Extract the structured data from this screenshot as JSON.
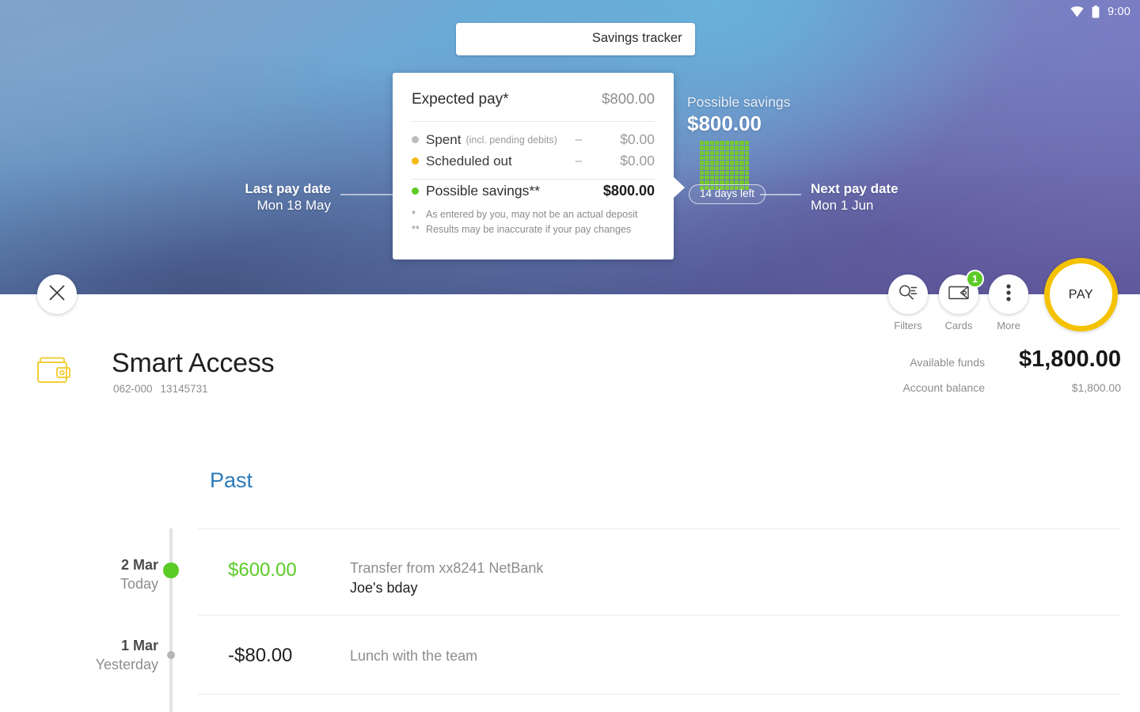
{
  "status_bar": {
    "wifi_icon": "wifi-icon",
    "battery_icon": "battery-icon",
    "time": "9:00"
  },
  "tabs": [
    {
      "label": "Running balance",
      "active": false
    },
    {
      "label": "Savings tracker",
      "active": true
    }
  ],
  "timeline": {
    "last_pay": {
      "title": "Last pay date",
      "date": "Mon 18 May"
    },
    "next_pay": {
      "title": "Next pay date",
      "date": "Mon 1 Jun"
    },
    "days_left_pill": "14 days left"
  },
  "savings_panel": {
    "title": "Possible savings",
    "amount": "$800.00",
    "grid_cells": 100,
    "grid_color": "#76c92c"
  },
  "detail_card": {
    "expected_pay": {
      "label": "Expected pay*",
      "amount": "$800.00"
    },
    "rows": [
      {
        "label": "Spent",
        "sub": "(incl. pending debits)",
        "dash": "–",
        "amount": "$0.00",
        "dot": "grey",
        "dot_color": "#bdbdbd"
      },
      {
        "label": "Scheduled out",
        "sub": "",
        "dash": "–",
        "amount": "$0.00",
        "dot": "amber",
        "dot_color": "#f6b911"
      }
    ],
    "possible_savings": {
      "label": "Possible savings**",
      "amount": "$800.00",
      "dot_color": "#5bcb26"
    },
    "notes": [
      {
        "marker": "*",
        "text": "As entered by you, may not be an actual deposit"
      },
      {
        "marker": "**",
        "text": "Results may be inaccurate if your pay changes"
      }
    ]
  },
  "toolbar": {
    "close_label": "close-icon",
    "items": [
      {
        "caption": "Filters",
        "icon": "search-filter-icon",
        "badge": null
      },
      {
        "caption": "Cards",
        "icon": "card-icon",
        "badge": "1"
      },
      {
        "caption": "More",
        "icon": "more-vertical-icon",
        "badge": null
      }
    ],
    "pay_label": "PAY",
    "pay_ring_color": "#f4c200"
  },
  "account": {
    "icon": "wallet-icon",
    "name": "Smart Access",
    "bsb": "062-000",
    "number": "13145731",
    "available_funds_label": "Available funds",
    "available_funds_value": "$1,800.00",
    "account_balance_label": "Account balance",
    "account_balance_value": "$1,800.00"
  },
  "transactions": {
    "section_title": "Past",
    "items": [
      {
        "date_day": "2 Mar",
        "date_rel": "Today",
        "amount": "$600.00",
        "amount_color": "#5bcb26",
        "description": "Transfer from xx8241 NetBank",
        "memo": "Joe's bday",
        "node": "large-green"
      },
      {
        "date_day": "1 Mar",
        "date_rel": "Yesterday",
        "amount": "-$80.00",
        "amount_color": "#1f1f1f",
        "description": "Lunch with the team",
        "memo": "",
        "node": "small-grey"
      }
    ]
  }
}
